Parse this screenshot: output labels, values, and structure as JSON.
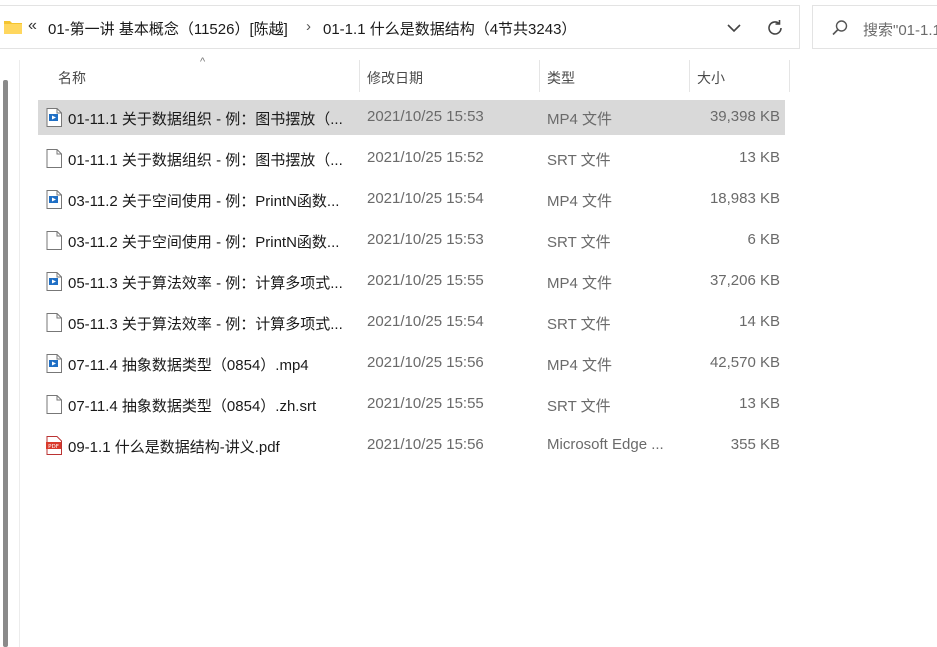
{
  "address": {
    "overflow_glyph": "«",
    "crumbs": [
      "01-第一讲 基本概念（11526）[陈越]",
      "01-1.1 什么是数据结构（4节共3243）"
    ],
    "separator": "›"
  },
  "search": {
    "placeholder": "搜索\"01-1.1"
  },
  "columns": {
    "name": "名称",
    "date": "修改日期",
    "type": "类型",
    "size": "大小"
  },
  "files": [
    {
      "icon": "video-file-icon",
      "name": "01-11.1 关于数据组织 - 例：图书摆放（...",
      "date": "2021/10/25 15:53",
      "type": "MP4 文件",
      "size": "39,398 KB",
      "selected": true
    },
    {
      "icon": "text-file-icon",
      "name": "01-11.1 关于数据组织 - 例：图书摆放（...",
      "date": "2021/10/25 15:52",
      "type": "SRT 文件",
      "size": "13 KB"
    },
    {
      "icon": "video-file-icon",
      "name": "03-11.2 关于空间使用 - 例：PrintN函数...",
      "date": "2021/10/25 15:54",
      "type": "MP4 文件",
      "size": "18,983 KB"
    },
    {
      "icon": "text-file-icon",
      "name": "03-11.2 关于空间使用 - 例：PrintN函数...",
      "date": "2021/10/25 15:53",
      "type": "SRT 文件",
      "size": "6 KB"
    },
    {
      "icon": "video-file-icon",
      "name": "05-11.3 关于算法效率 - 例：计算多项式...",
      "date": "2021/10/25 15:55",
      "type": "MP4 文件",
      "size": "37,206 KB"
    },
    {
      "icon": "text-file-icon",
      "name": "05-11.3 关于算法效率 - 例：计算多项式...",
      "date": "2021/10/25 15:54",
      "type": "SRT 文件",
      "size": "14 KB"
    },
    {
      "icon": "video-file-icon",
      "name": "07-11.4 抽象数据类型（0854）.mp4",
      "date": "2021/10/25 15:56",
      "type": "MP4 文件",
      "size": "42,570 KB"
    },
    {
      "icon": "text-file-icon",
      "name": "07-11.4 抽象数据类型（0854）.zh.srt",
      "date": "2021/10/25 15:55",
      "type": "SRT 文件",
      "size": "13 KB"
    },
    {
      "icon": "pdf-file-icon",
      "name": "09-1.1 什么是数据结构-讲义.pdf",
      "date": "2021/10/25 15:56",
      "type": "Microsoft Edge ...",
      "size": "355 KB"
    }
  ],
  "colors": {
    "selection": "#d9d9d9",
    "folder": "#f4c430",
    "pdf": "#d93a2b"
  }
}
